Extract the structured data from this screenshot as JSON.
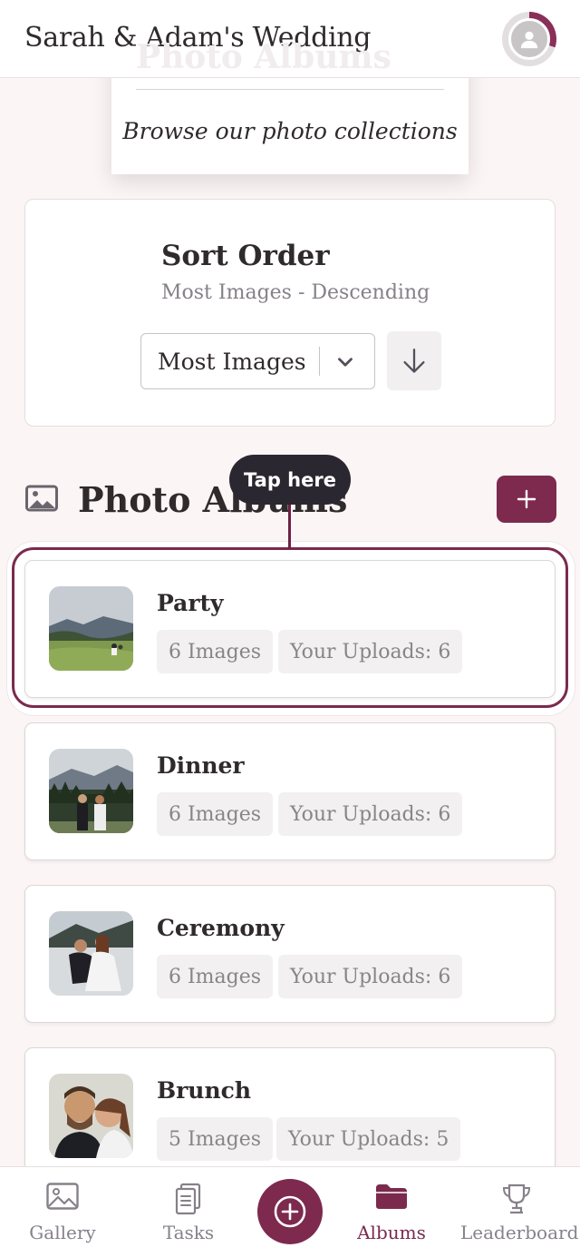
{
  "header": {
    "title": "Sarah & Adam's Wedding",
    "ghost_title": "Photo Albums"
  },
  "browse": {
    "subtitle": "Browse our photo collections"
  },
  "sort": {
    "title": "Sort Order",
    "subtitle": "Most Images - Descending",
    "selected": "Most Images"
  },
  "section": {
    "title": "Photo Albums"
  },
  "tooltip": {
    "text": "Tap here"
  },
  "albums": [
    {
      "name": "Party",
      "count": "6 Images",
      "uploads": "Your Uploads: 6"
    },
    {
      "name": "Dinner",
      "count": "6 Images",
      "uploads": "Your Uploads: 6"
    },
    {
      "name": "Ceremony",
      "count": "6 Images",
      "uploads": "Your Uploads: 6"
    },
    {
      "name": "Brunch",
      "count": "5 Images",
      "uploads": "Your Uploads: 5"
    }
  ],
  "nav": {
    "gallery": "Gallery",
    "tasks": "Tasks",
    "albums": "Albums",
    "leaderboard": "Leaderboard"
  },
  "colors": {
    "accent": "#7d2a4e",
    "background": "#fbf5f6",
    "muted_text": "#86808a"
  }
}
